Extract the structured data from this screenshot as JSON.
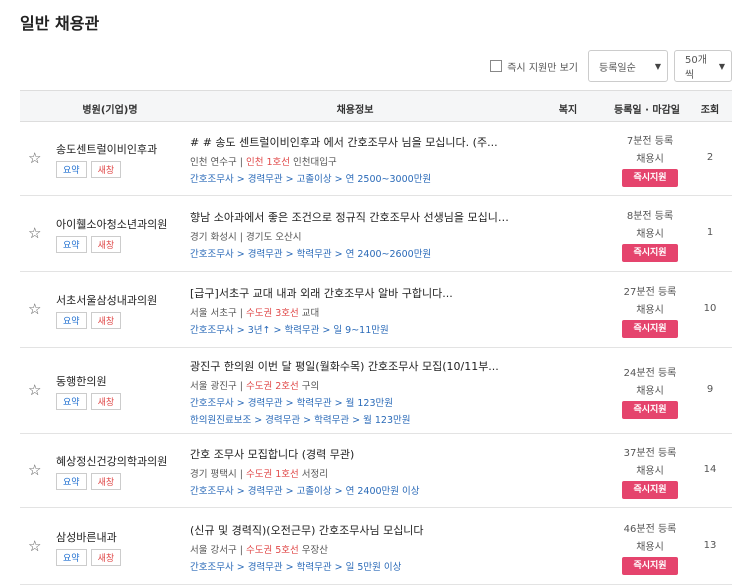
{
  "page_title": "일반 채용관",
  "toolbar": {
    "instant_only": "즉시 지원만 보기",
    "sort_value": "등록일순",
    "per_page_value": "50개씩"
  },
  "headers": {
    "company": "병원(기업)명",
    "info": "채용정보",
    "benefits": "복지",
    "dates": "등록일 · 마감일",
    "views": "조회"
  },
  "labels": {
    "summary": "요약",
    "new_window": "새창",
    "apply": "즉시지원",
    "sep": " | "
  },
  "rows": [
    {
      "company": "송도센트럴이비인후과",
      "title": "# # 송도 센트럴이비인후과 에서 간호조무사 님을 모십니다. (주...",
      "loc": "인천 연수구",
      "line": "인천 1호선",
      "station": "인천대입구",
      "cat1": "간호조무사 > 경력무관 > 고졸이상 > 연 2500~3000만원",
      "cat2": "",
      "posted": "7분전 등록",
      "deadline": "채용시",
      "views": "2"
    },
    {
      "company": "아이휄소아청소년과의원",
      "title": "향남 소아과에서 좋은 조건으로 정규직 간호조무사 선생님을 모십니다...",
      "loc": "경기 화성시",
      "line": "",
      "station": "경기도 오산시",
      "cat1": "간호조무사 > 경력무관 > 학력무관 > 연 2400~2600만원",
      "cat2": "",
      "posted": "8분전 등록",
      "deadline": "채용시",
      "views": "1"
    },
    {
      "company": "서초서울삼성내과의원",
      "title": "[급구]서초구 교대 내과 외래 간호조무사 알바 구합니다...",
      "loc": "서울 서초구",
      "line": "수도권 3호선",
      "station": "교대",
      "cat1": "간호조무사 > 3년↑ > 학력무관 > 일 9~11만원",
      "cat2": "",
      "posted": "27분전 등록",
      "deadline": "채용시",
      "views": "10"
    },
    {
      "company": "동행한의원",
      "title": "광진구 한의원 이번 달 평일(월화수목) 간호조무사 모집(10/11부...",
      "loc": "서울 광진구",
      "line": "수도권 2호선",
      "station": "구의",
      "cat1": "간호조무사 > 경력무관 > 학력무관 > 월 123만원",
      "cat2": "한의원진료보조 > 경력무관 > 학력무관 > 월 123만원",
      "posted": "24분전 등록",
      "deadline": "채용시",
      "views": "9"
    },
    {
      "company": "혜상정신건강의학과의원",
      "title": "간호 조무사 모집합니다 (경력 무관)",
      "loc": "경기 평택시",
      "line": "수도권 1호선",
      "station": "서정리",
      "cat1": "간호조무사 > 경력무관 > 고졸이상 > 연 2400만원 이상",
      "cat2": "",
      "posted": "37분전 등록",
      "deadline": "채용시",
      "views": "14"
    },
    {
      "company": "삼성바른내과",
      "title": "(신규 및 경력직)(오전근무) 간호조무사님 모십니다",
      "loc": "서울 강서구",
      "line": "수도권 5호선",
      "station": "우장산",
      "cat1": "간호조무사 > 경력무관 > 학력무관 > 일 5만원 이상",
      "cat2": "",
      "posted": "46분전 등록",
      "deadline": "채용시",
      "views": "13"
    }
  ]
}
